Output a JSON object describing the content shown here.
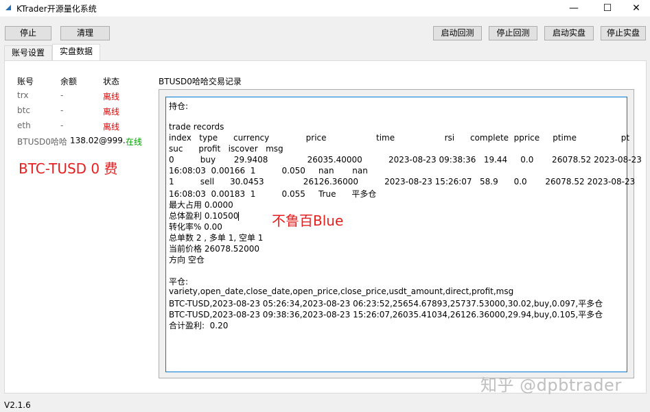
{
  "window": {
    "title": "KTrader开源量化系统"
  },
  "toolbar": {
    "stop": "停止",
    "clear": "清理",
    "start_backtest": "启动回测",
    "stop_backtest": "停止回测",
    "start_live": "启动实盘",
    "stop_live": "停止实盘"
  },
  "tabs": [
    {
      "label": "账号设置",
      "active": false
    },
    {
      "label": "实盘数据",
      "active": true
    }
  ],
  "accounts": {
    "headers": {
      "account": "账号",
      "balance": "余额",
      "status": "状态"
    },
    "rows": [
      {
        "account": "trx",
        "balance": "-",
        "status": "离线"
      },
      {
        "account": "btc",
        "balance": "-",
        "status": "离线"
      },
      {
        "account": "eth",
        "balance": "-",
        "status": "离线"
      },
      {
        "account": "BTUSD0哈哈",
        "balance": "138.02@999.",
        "status": "在线"
      }
    ],
    "annotation": "BTC-TUSD 0 费"
  },
  "log": {
    "label": "BTUSD0哈哈交易记录",
    "annotation": "不鲁百Blue",
    "lines": [
      "持仓:",
      "",
      "trade records",
      "index   type      currency              price                   time                   rsi      complete  pprice     ptime                 pt",
      "suc      profit   iscover   msg",
      "0          buy       29.9408               26035.40000          2023-08-23 09:38:36   19.44     0.0       26078.52 2023-08-23",
      "16:08:03  0.00166  1          0.050     nan       nan",
      "1          sell      30.0453               26126.36000          2023-08-23 15:26:07   58.9      0.0       26078.52 2023-08-23",
      "16:08:03  0.00183  1          0.055     True      平多仓",
      "最大占用 0.0000",
      "总体盈利 0.10500",
      "转化率% 0.00",
      "总单数 2 , 多单 1, 空单 1",
      "当前价格 26078.52000",
      "方向 空仓",
      "",
      "平仓:",
      "variety,open_date,close_date,open_price,close_price,usdt_amount,direct,profit,msg",
      "BTC-TUSD,2023-08-23 05:26:34,2023-08-23 06:23:52,25654.67893,25737.53000,30.02,buy,0.097,平多仓",
      "BTC-TUSD,2023-08-23 09:38:36,2023-08-23 15:26:07,26035.41034,26126.36000,29.94,buy,0.105,平多仓",
      "合计盈利:  0.20"
    ]
  },
  "footer": {
    "version": "V2.1.6"
  },
  "watermark": "知乎 @dpbtrader",
  "colors": {
    "offline": "#e60000",
    "online": "#00a000",
    "focus_border": "#0078d7"
  }
}
